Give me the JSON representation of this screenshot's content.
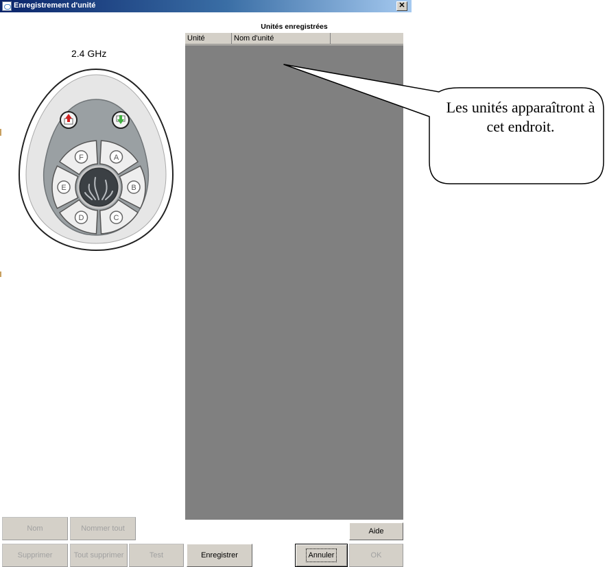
{
  "window": {
    "title": "Enregistrement d'unité",
    "close_glyph": "✕"
  },
  "remote": {
    "frequency": "2.4 GHz",
    "buttons": [
      "A",
      "B",
      "C",
      "D",
      "E",
      "F"
    ],
    "center_icon": "flame-icon",
    "top_icons": [
      "up-arrow-icon",
      "down-arrow-icon"
    ],
    "colors": {
      "up_arrow": "#d02020",
      "down_arrow": "#40b040"
    }
  },
  "list": {
    "title": "Unités enregistrées",
    "columns": [
      "Unité",
      "Nom d'unité",
      ""
    ],
    "rows": []
  },
  "buttons": {
    "nom": "Nom",
    "nommer_tout": "Nommer tout",
    "aide": "Aide",
    "supprimer": "Supprimer",
    "tout_supprimer": "Tout supprimer",
    "test": "Test",
    "enregistrer": "Enregistrer",
    "annuler": "Annuler",
    "ok": "OK"
  },
  "callout": {
    "text": "Les unités apparaîtront à cet endroit."
  }
}
